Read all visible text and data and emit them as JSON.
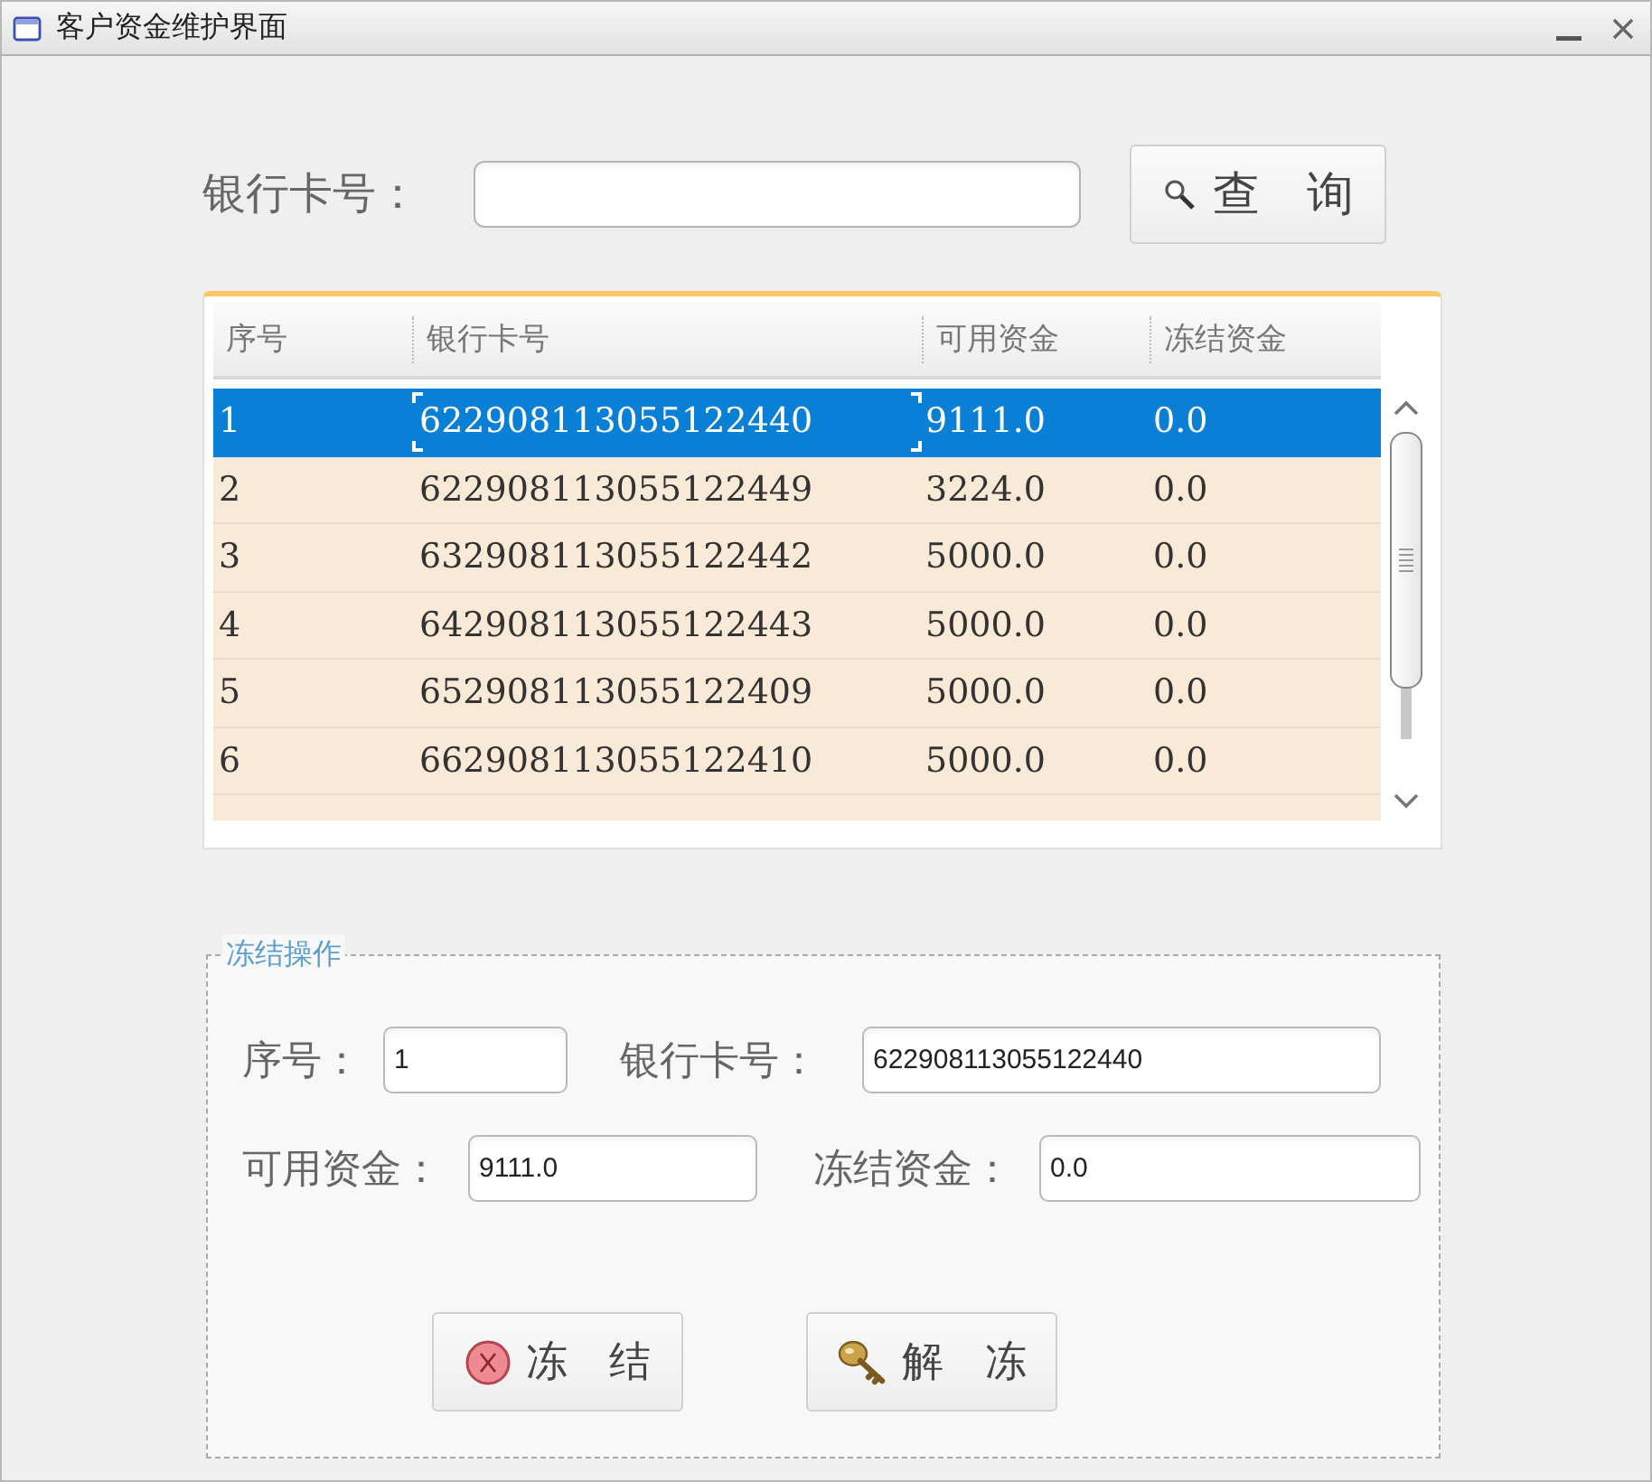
{
  "window": {
    "title": "客户资金维护界面"
  },
  "search": {
    "label": "银行卡号：",
    "button": "查　询"
  },
  "table": {
    "columns": [
      "序号",
      "银行卡号",
      "可用资金",
      "冻结资金"
    ],
    "rows": [
      {
        "cells": [
          "1",
          "622908113055122440",
          "9111.0",
          "0.0"
        ],
        "selected": true
      },
      {
        "cells": [
          "2",
          "622908113055122449",
          "3224.0",
          "0.0"
        ],
        "selected": false
      },
      {
        "cells": [
          "3",
          "632908113055122442",
          "5000.0",
          "0.0"
        ],
        "selected": false
      },
      {
        "cells": [
          "4",
          "642908113055122443",
          "5000.0",
          "0.0"
        ],
        "selected": false
      },
      {
        "cells": [
          "5",
          "652908113055122409",
          "5000.0",
          "0.0"
        ],
        "selected": false
      },
      {
        "cells": [
          "6",
          "662908113055122410",
          "5000.0",
          "0.0"
        ],
        "selected": false
      }
    ]
  },
  "freeze_panel": {
    "title": "冻结操作",
    "fields": [
      {
        "label": "序号：",
        "value": "1"
      },
      {
        "label": "银行卡号：",
        "value": "622908113055122440"
      },
      {
        "label": "可用资金：",
        "value": "9111.0"
      },
      {
        "label": "冻结资金：",
        "value": "0.0"
      }
    ],
    "buttons": [
      {
        "label": "冻　结",
        "kind": "freeze"
      },
      {
        "label": "解　冻",
        "kind": "unfreeze"
      }
    ]
  }
}
